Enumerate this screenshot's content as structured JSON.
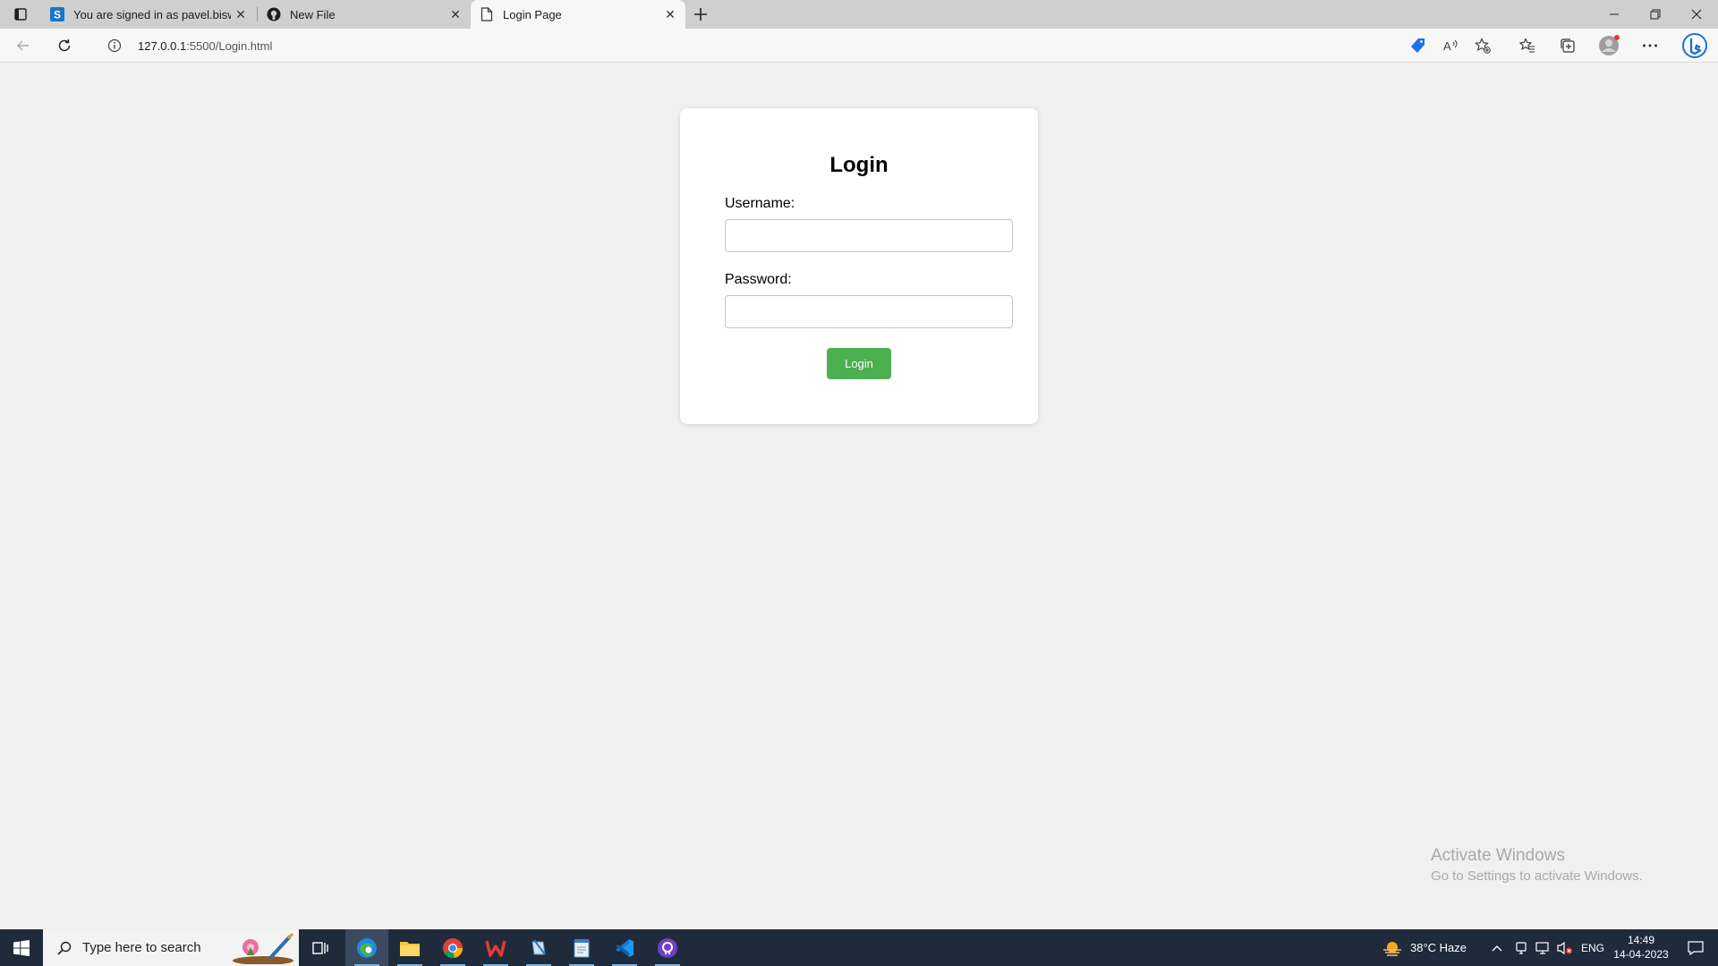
{
  "browser": {
    "tabs": [
      {
        "title": "You are signed in as pavel.biswas",
        "icon": "s-app-icon"
      },
      {
        "title": "New File",
        "icon": "github-icon"
      },
      {
        "title": "Login Page",
        "icon": "page-icon"
      }
    ],
    "address": {
      "host": "127.0.0.1",
      "path": ":5500/Login.html"
    }
  },
  "page": {
    "heading": "Login",
    "username_label": "Username:",
    "password_label": "Password:",
    "username_value": "",
    "password_value": "",
    "login_button": "Login",
    "accent": "#4caf50"
  },
  "watermark": {
    "title": "Activate Windows",
    "subtitle": "Go to Settings to activate Windows."
  },
  "taskbar": {
    "search_placeholder": "Type here to search",
    "weather": "38°C  Haze",
    "language": "ENG",
    "time": "14:49",
    "date": "14-04-2023"
  }
}
